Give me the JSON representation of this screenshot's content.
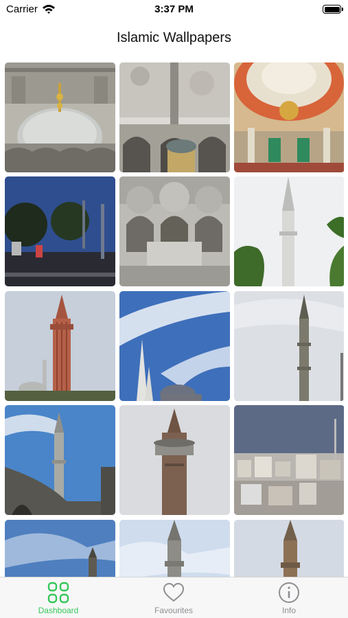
{
  "status_bar": {
    "carrier": "Carrier",
    "time": "3:37 PM"
  },
  "nav": {
    "title": "Islamic Wallpapers"
  },
  "colors": {
    "accent": "#34c759",
    "inactive": "#8e8e93",
    "tab_bg": "#f7f7f7"
  },
  "wallpapers": [
    {
      "name": "mosque-dome-gold-finial"
    },
    {
      "name": "mosque-courtyard-minaret"
    },
    {
      "name": "mosque-interior-dome"
    },
    {
      "name": "park-trees-minarets-dusk"
    },
    {
      "name": "mosque-courtyard-fountain"
    },
    {
      "name": "white-minaret-palm"
    },
    {
      "name": "fluted-brick-minaret"
    },
    {
      "name": "minarets-blue-sky"
    },
    {
      "name": "stone-minaret-cloudy"
    },
    {
      "name": "mosque-arches-minaret"
    },
    {
      "name": "stone-minaret-balcony"
    },
    {
      "name": "hillside-city"
    },
    {
      "name": "minaret-partial-1"
    },
    {
      "name": "minaret-partial-2"
    },
    {
      "name": "minaret-partial-3"
    }
  ],
  "tabs": [
    {
      "label": "Dashboard",
      "icon": "grid-icon",
      "active": true
    },
    {
      "label": "Favourites",
      "icon": "heart-icon",
      "active": false
    },
    {
      "label": "Info",
      "icon": "info-icon",
      "active": false
    }
  ]
}
